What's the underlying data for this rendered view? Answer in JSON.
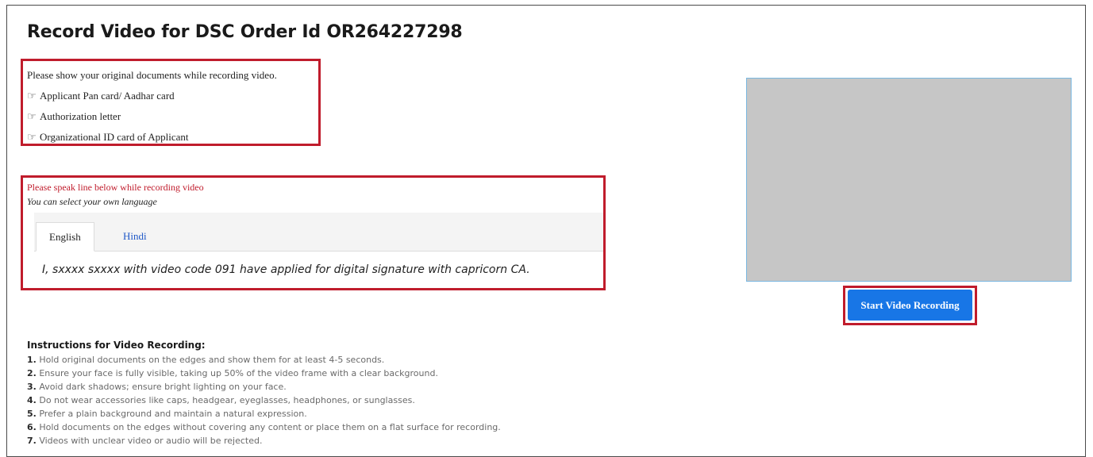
{
  "page": {
    "title": "Record Video for DSC Order Id OR264227298"
  },
  "documents": {
    "intro": "Please show your original documents while recording video.",
    "items": [
      {
        "icon": "pointing-hand-icon",
        "label": "Applicant Pan card/ Aadhar card"
      },
      {
        "icon": "pointing-hand-icon",
        "label": "Authorization letter"
      },
      {
        "icon": "pointing-hand-icon",
        "label": "Organizational ID card of Applicant"
      }
    ]
  },
  "speak": {
    "instruction": "Please speak line below while recording video",
    "language_note": "You can select your own language",
    "tabs": [
      {
        "label": "English",
        "active": true
      },
      {
        "label": "Hindi",
        "active": false
      }
    ],
    "line": "I, sxxxx  sxxxx with video code 091 have applied for digital signature with capricorn CA."
  },
  "instructions": {
    "heading": "Instructions for Video Recording:",
    "items": [
      {
        "num": "1.",
        "text": "Hold original documents on the edges and show them for at least 4-5 seconds."
      },
      {
        "num": "2.",
        "text": "Ensure your face is fully visible, taking up 50% of the video frame with a clear background."
      },
      {
        "num": "3.",
        "text": "Avoid dark shadows; ensure bright lighting on your face."
      },
      {
        "num": "4.",
        "text": "Do not wear accessories like caps, headgear, eyeglasses, headphones, or sunglasses."
      },
      {
        "num": "5.",
        "text": "Prefer a plain background and maintain a natural expression."
      },
      {
        "num": "6.",
        "text": "Hold documents on the edges without covering any content or place them on a flat surface for recording."
      },
      {
        "num": "7.",
        "text": "Videos with unclear video or audio will be rejected."
      }
    ]
  },
  "video": {
    "record_button_label": "Start Video Recording"
  },
  "colors": {
    "highlight": "#c01c2c",
    "button": "#1876e6",
    "link": "#1f58c8",
    "preview": "#c6c6c6"
  }
}
